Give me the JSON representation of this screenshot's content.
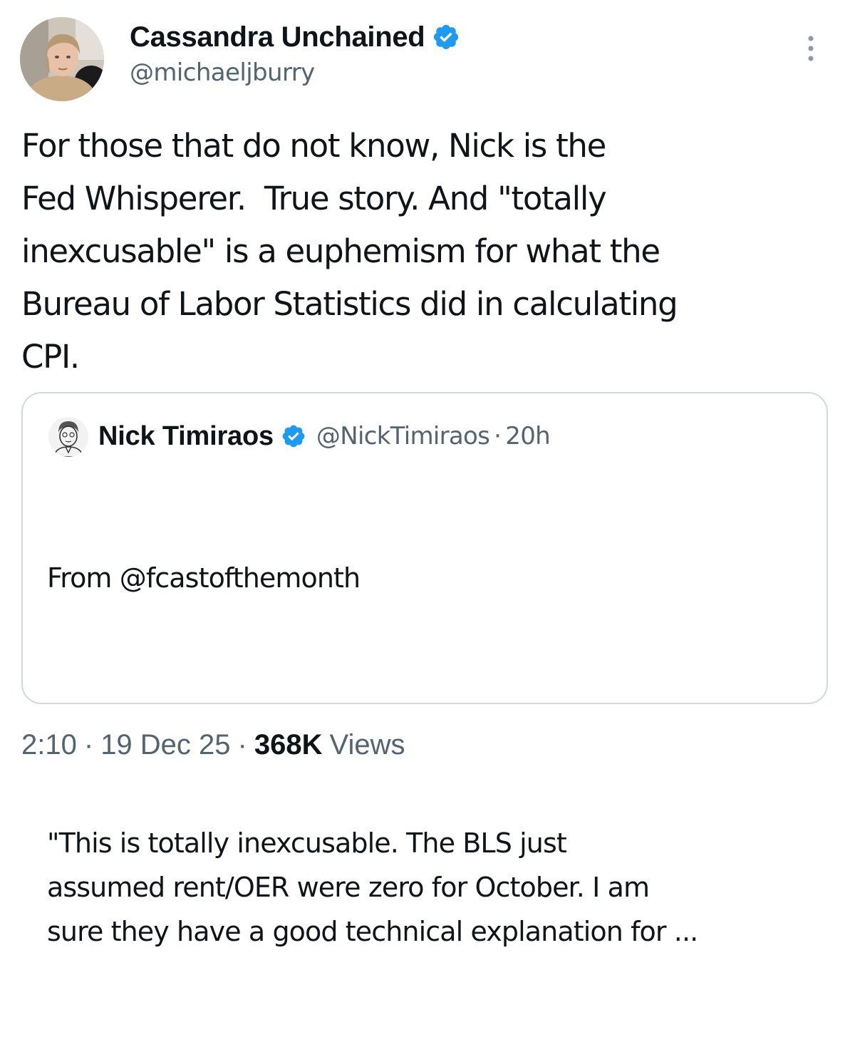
{
  "author": {
    "display_name": "Cassandra Unchained",
    "handle": "@michaeljburry",
    "verified_icon": "verified-badge-icon",
    "avatar": "user-avatar"
  },
  "more_icon": "more-options-icon",
  "tweet": {
    "text": "For those that do not know, Nick is the\nFed Whisperer.  True story. And \"totally\ninexcusable\" is a euphemism for what the\nBureau of Labor Statistics did in calculating\nCPI."
  },
  "quoted_tweet": {
    "display_name": "Nick Timiraos",
    "handle": "@NickTimiraos",
    "separator": "·",
    "time": "20h",
    "line1": "From @fcastofthemonth",
    "line2": "\"This is totally inexcusable. The BLS just\nassumed rent/OER were zero for October. I am\nsure they have a good technical explanation for ..."
  },
  "meta": {
    "time": "2:10",
    "separator": "·",
    "date": "19 Dec 25",
    "views_count": "368K",
    "views_label": "Views"
  },
  "colors": {
    "verified_blue": "#1d9bf0",
    "secondary_text": "#536471",
    "primary_text": "#0f1419",
    "border": "#cfd9de"
  }
}
